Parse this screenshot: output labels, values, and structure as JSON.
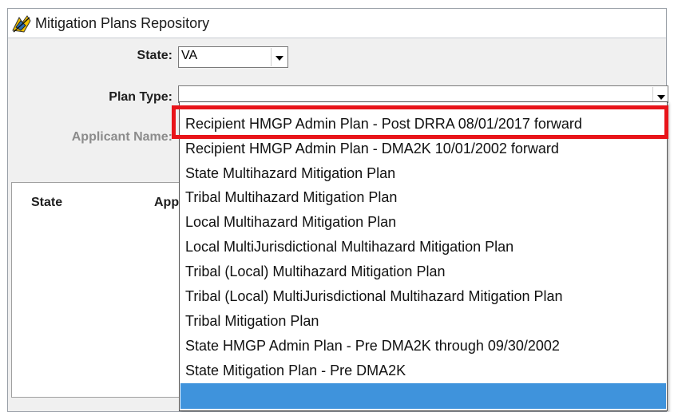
{
  "window": {
    "title": "Mitigation Plans Repository"
  },
  "form": {
    "state_label": "State:",
    "state_value": "VA",
    "plan_type_label": "Plan Type:",
    "plan_type_value": "",
    "applicant_name_label": "Applicant Name:"
  },
  "grid": {
    "columns": [
      "State",
      "App"
    ]
  },
  "dropdown": {
    "options": [
      "Recipient HMGP Admin Plan - Post DRRA 08/01/2017 forward",
      "Recipient HMGP Admin Plan - DMA2K 10/01/2002 forward",
      "State Multihazard Mitigation Plan",
      "Tribal Multihazard Mitigation Plan",
      "Local Multihazard Mitigation Plan",
      "Local MultiJurisdictional Multihazard Mitigation Plan",
      "Tribal (Local) Multihazard Mitigation Plan",
      "Tribal (Local) MultiJurisdictional Multihazard Mitigation Plan",
      "Tribal Mitigation Plan",
      "State HMGP Admin Plan - Pre DMA2K through 09/30/2002",
      "State Mitigation Plan - Pre DMA2K",
      ""
    ],
    "highlighted_index": 11
  },
  "annotation": {
    "highlight_color": "#e8141a",
    "highlighted_option_index": 0
  }
}
